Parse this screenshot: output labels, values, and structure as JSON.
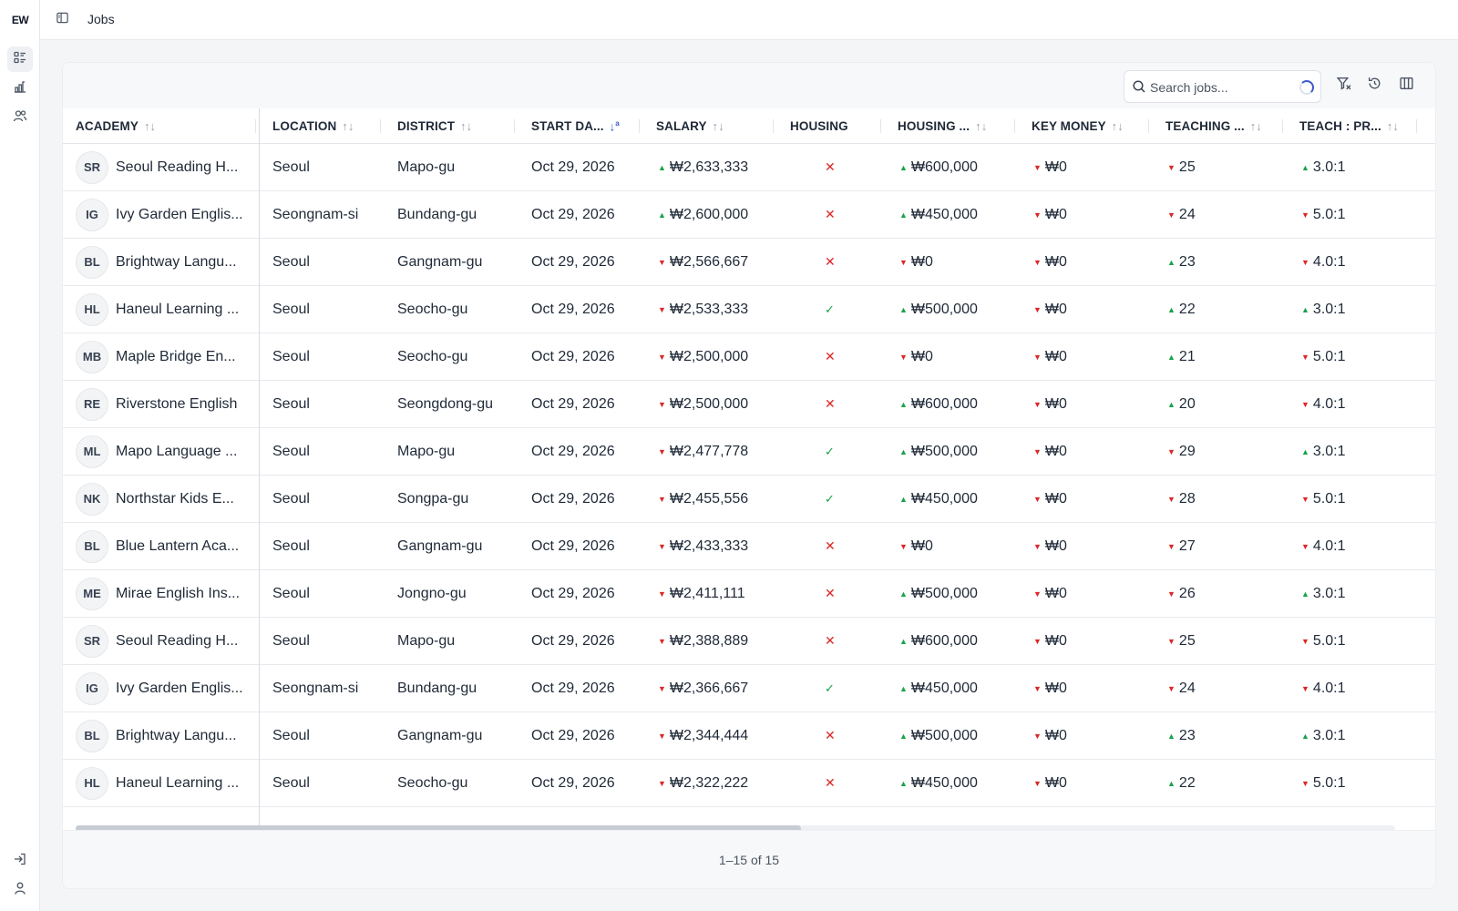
{
  "app": {
    "logo": "EW",
    "page_title": "Jobs"
  },
  "rail": {
    "items": [
      {
        "icon": "list-details-icon",
        "active": true
      },
      {
        "icon": "chart-icon",
        "active": false
      },
      {
        "icon": "users-icon",
        "active": false
      }
    ],
    "bottom": [
      {
        "icon": "login-icon"
      },
      {
        "icon": "user-icon"
      }
    ]
  },
  "toolbar": {
    "search_placeholder": "Search jobs...",
    "buttons": [
      "filter-icon",
      "reset-icon",
      "columns-icon"
    ]
  },
  "columns": [
    {
      "key": "academy",
      "label": "ACADEMY",
      "sort": "none"
    },
    {
      "key": "location",
      "label": "LOCATION",
      "sort": "none"
    },
    {
      "key": "district",
      "label": "DISTRICT",
      "sort": "none"
    },
    {
      "key": "start_date",
      "label": "START DA...",
      "sort": "ascending"
    },
    {
      "key": "salary",
      "label": "SALARY",
      "sort": "none"
    },
    {
      "key": "housing",
      "label": "HOUSING",
      "sort": "none"
    },
    {
      "key": "housing_allowance",
      "label": "HOUSING ...",
      "sort": "none"
    },
    {
      "key": "key_money",
      "label": "KEY MONEY",
      "sort": "none"
    },
    {
      "key": "teaching",
      "label": "TEACHING ...",
      "sort": "none"
    },
    {
      "key": "ratio",
      "label": "TEACH : PR...",
      "sort": "none"
    }
  ],
  "rows": [
    {
      "initials": "SR",
      "academy": "Seoul Reading H...",
      "location": "Seoul",
      "district": "Mapo-gu",
      "start_date": "Oct 29, 2026",
      "salary": "₩2,633,333",
      "salary_trend": "up",
      "housing": false,
      "housing_amount": "₩600,000",
      "housing_trend": "up",
      "key_money": "₩0",
      "key_trend": "down",
      "teaching": "25",
      "teaching_trend": "down",
      "ratio": "3.0:1",
      "ratio_trend": "up"
    },
    {
      "initials": "IG",
      "academy": "Ivy Garden Englis...",
      "location": "Seongnam-si",
      "district": "Bundang-gu",
      "start_date": "Oct 29, 2026",
      "salary": "₩2,600,000",
      "salary_trend": "up",
      "housing": false,
      "housing_amount": "₩450,000",
      "housing_trend": "up",
      "key_money": "₩0",
      "key_trend": "down",
      "teaching": "24",
      "teaching_trend": "down",
      "ratio": "5.0:1",
      "ratio_trend": "down"
    },
    {
      "initials": "BL",
      "academy": "Brightway Langu...",
      "location": "Seoul",
      "district": "Gangnam-gu",
      "start_date": "Oct 29, 2026",
      "salary": "₩2,566,667",
      "salary_trend": "down",
      "housing": false,
      "housing_amount": "₩0",
      "housing_trend": "down",
      "key_money": "₩0",
      "key_trend": "down",
      "teaching": "23",
      "teaching_trend": "up",
      "ratio": "4.0:1",
      "ratio_trend": "down"
    },
    {
      "initials": "HL",
      "academy": "Haneul Learning ...",
      "location": "Seoul",
      "district": "Seocho-gu",
      "start_date": "Oct 29, 2026",
      "salary": "₩2,533,333",
      "salary_trend": "down",
      "housing": true,
      "housing_amount": "₩500,000",
      "housing_trend": "up",
      "key_money": "₩0",
      "key_trend": "down",
      "teaching": "22",
      "teaching_trend": "up",
      "ratio": "3.0:1",
      "ratio_trend": "up"
    },
    {
      "initials": "MB",
      "academy": "Maple Bridge En...",
      "location": "Seoul",
      "district": "Seocho-gu",
      "start_date": "Oct 29, 2026",
      "salary": "₩2,500,000",
      "salary_trend": "down",
      "housing": false,
      "housing_amount": "₩0",
      "housing_trend": "down",
      "key_money": "₩0",
      "key_trend": "down",
      "teaching": "21",
      "teaching_trend": "up",
      "ratio": "5.0:1",
      "ratio_trend": "down"
    },
    {
      "initials": "RE",
      "academy": "Riverstone English",
      "location": "Seoul",
      "district": "Seongdong-gu",
      "start_date": "Oct 29, 2026",
      "salary": "₩2,500,000",
      "salary_trend": "down",
      "housing": false,
      "housing_amount": "₩600,000",
      "housing_trend": "up",
      "key_money": "₩0",
      "key_trend": "down",
      "teaching": "20",
      "teaching_trend": "up",
      "ratio": "4.0:1",
      "ratio_trend": "down"
    },
    {
      "initials": "ML",
      "academy": "Mapo Language ...",
      "location": "Seoul",
      "district": "Mapo-gu",
      "start_date": "Oct 29, 2026",
      "salary": "₩2,477,778",
      "salary_trend": "down",
      "housing": true,
      "housing_amount": "₩500,000",
      "housing_trend": "up",
      "key_money": "₩0",
      "key_trend": "down",
      "teaching": "29",
      "teaching_trend": "down",
      "ratio": "3.0:1",
      "ratio_trend": "up"
    },
    {
      "initials": "NK",
      "academy": "Northstar Kids E...",
      "location": "Seoul",
      "district": "Songpa-gu",
      "start_date": "Oct 29, 2026",
      "salary": "₩2,455,556",
      "salary_trend": "down",
      "housing": true,
      "housing_amount": "₩450,000",
      "housing_trend": "up",
      "key_money": "₩0",
      "key_trend": "down",
      "teaching": "28",
      "teaching_trend": "down",
      "ratio": "5.0:1",
      "ratio_trend": "down"
    },
    {
      "initials": "BL",
      "academy": "Blue Lantern Aca...",
      "location": "Seoul",
      "district": "Gangnam-gu",
      "start_date": "Oct 29, 2026",
      "salary": "₩2,433,333",
      "salary_trend": "down",
      "housing": false,
      "housing_amount": "₩0",
      "housing_trend": "down",
      "key_money": "₩0",
      "key_trend": "down",
      "teaching": "27",
      "teaching_trend": "down",
      "ratio": "4.0:1",
      "ratio_trend": "down"
    },
    {
      "initials": "ME",
      "academy": "Mirae English Ins...",
      "location": "Seoul",
      "district": "Jongno-gu",
      "start_date": "Oct 29, 2026",
      "salary": "₩2,411,111",
      "salary_trend": "down",
      "housing": false,
      "housing_amount": "₩500,000",
      "housing_trend": "up",
      "key_money": "₩0",
      "key_trend": "down",
      "teaching": "26",
      "teaching_trend": "down",
      "ratio": "3.0:1",
      "ratio_trend": "up"
    },
    {
      "initials": "SR",
      "academy": "Seoul Reading H...",
      "location": "Seoul",
      "district": "Mapo-gu",
      "start_date": "Oct 29, 2026",
      "salary": "₩2,388,889",
      "salary_trend": "down",
      "housing": false,
      "housing_amount": "₩600,000",
      "housing_trend": "up",
      "key_money": "₩0",
      "key_trend": "down",
      "teaching": "25",
      "teaching_trend": "down",
      "ratio": "5.0:1",
      "ratio_trend": "down"
    },
    {
      "initials": "IG",
      "academy": "Ivy Garden Englis...",
      "location": "Seongnam-si",
      "district": "Bundang-gu",
      "start_date": "Oct 29, 2026",
      "salary": "₩2,366,667",
      "salary_trend": "down",
      "housing": true,
      "housing_amount": "₩450,000",
      "housing_trend": "up",
      "key_money": "₩0",
      "key_trend": "down",
      "teaching": "24",
      "teaching_trend": "down",
      "ratio": "4.0:1",
      "ratio_trend": "down"
    },
    {
      "initials": "BL",
      "academy": "Brightway Langu...",
      "location": "Seoul",
      "district": "Gangnam-gu",
      "start_date": "Oct 29, 2026",
      "salary": "₩2,344,444",
      "salary_trend": "down",
      "housing": false,
      "housing_amount": "₩500,000",
      "housing_trend": "up",
      "key_money": "₩0",
      "key_trend": "down",
      "teaching": "23",
      "teaching_trend": "up",
      "ratio": "3.0:1",
      "ratio_trend": "up"
    },
    {
      "initials": "HL",
      "academy": "Haneul Learning ...",
      "location": "Seoul",
      "district": "Seocho-gu",
      "start_date": "Oct 29, 2026",
      "salary": "₩2,322,222",
      "salary_trend": "down",
      "housing": false,
      "housing_amount": "₩450,000",
      "housing_trend": "up",
      "key_money": "₩0",
      "key_trend": "down",
      "teaching": "22",
      "teaching_trend": "up",
      "ratio": "5.0:1",
      "ratio_trend": "down"
    }
  ],
  "pagination": {
    "text": "1–15 of 15"
  },
  "colors": {
    "up": "#16a34a",
    "down": "#dc2626",
    "sort_active": "#3b5bcc"
  }
}
